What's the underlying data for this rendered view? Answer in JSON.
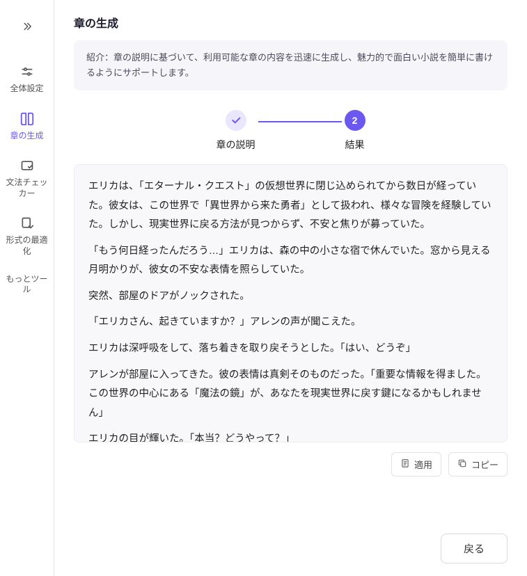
{
  "sidebar": {
    "items": [
      {
        "label": "全体設定"
      },
      {
        "label": "章の生成"
      },
      {
        "label": "文法チェッカー"
      },
      {
        "label": "形式の最適化"
      },
      {
        "label": "もっとツール"
      }
    ]
  },
  "page": {
    "title": "章の生成"
  },
  "intro": {
    "text": "紹介：章の説明に基づいて、利用可能な章の内容を迅速に生成し、魅力的で面白い小説を簡単に書けるようにサポートします。"
  },
  "stepper": {
    "step1": {
      "label": "章の説明"
    },
    "step2": {
      "label": "結果",
      "number": "2"
    }
  },
  "result": {
    "p1": "エリカは、「エターナル・クエスト」の仮想世界に閉じ込められてから数日が経っていた。彼女は、この世界で「異世界から来た勇者」として扱われ、様々な冒険を経験していた。しかし、現実世界に戻る方法が見つからず、不安と焦りが募っていた。",
    "p2": "「もう何日経ったんだろう…」エリカは、森の中の小さな宿で休んでいた。窓から見える月明かりが、彼女の不安な表情を照らしていた。",
    "p3": "突然、部屋のドアがノックされた。",
    "p4": "「エリカさん、起きていますか？」アレンの声が聞こえた。",
    "p5": "エリカは深呼吸をして、落ち着きを取り戻そうとした。「はい、どうぞ」",
    "p6": "アレンが部屋に入ってきた。彼の表情は真剣そのものだった。「重要な情報を得ました。この世界の中心にある「魔法の鏡」が、あなたを現実世界に戻す鍵になるかもしれません」",
    "p7": "エリカの目が輝いた。「本当？どうやって？」"
  },
  "actions": {
    "apply": "適用",
    "copy": "コピー"
  },
  "footer": {
    "back": "戻る"
  }
}
